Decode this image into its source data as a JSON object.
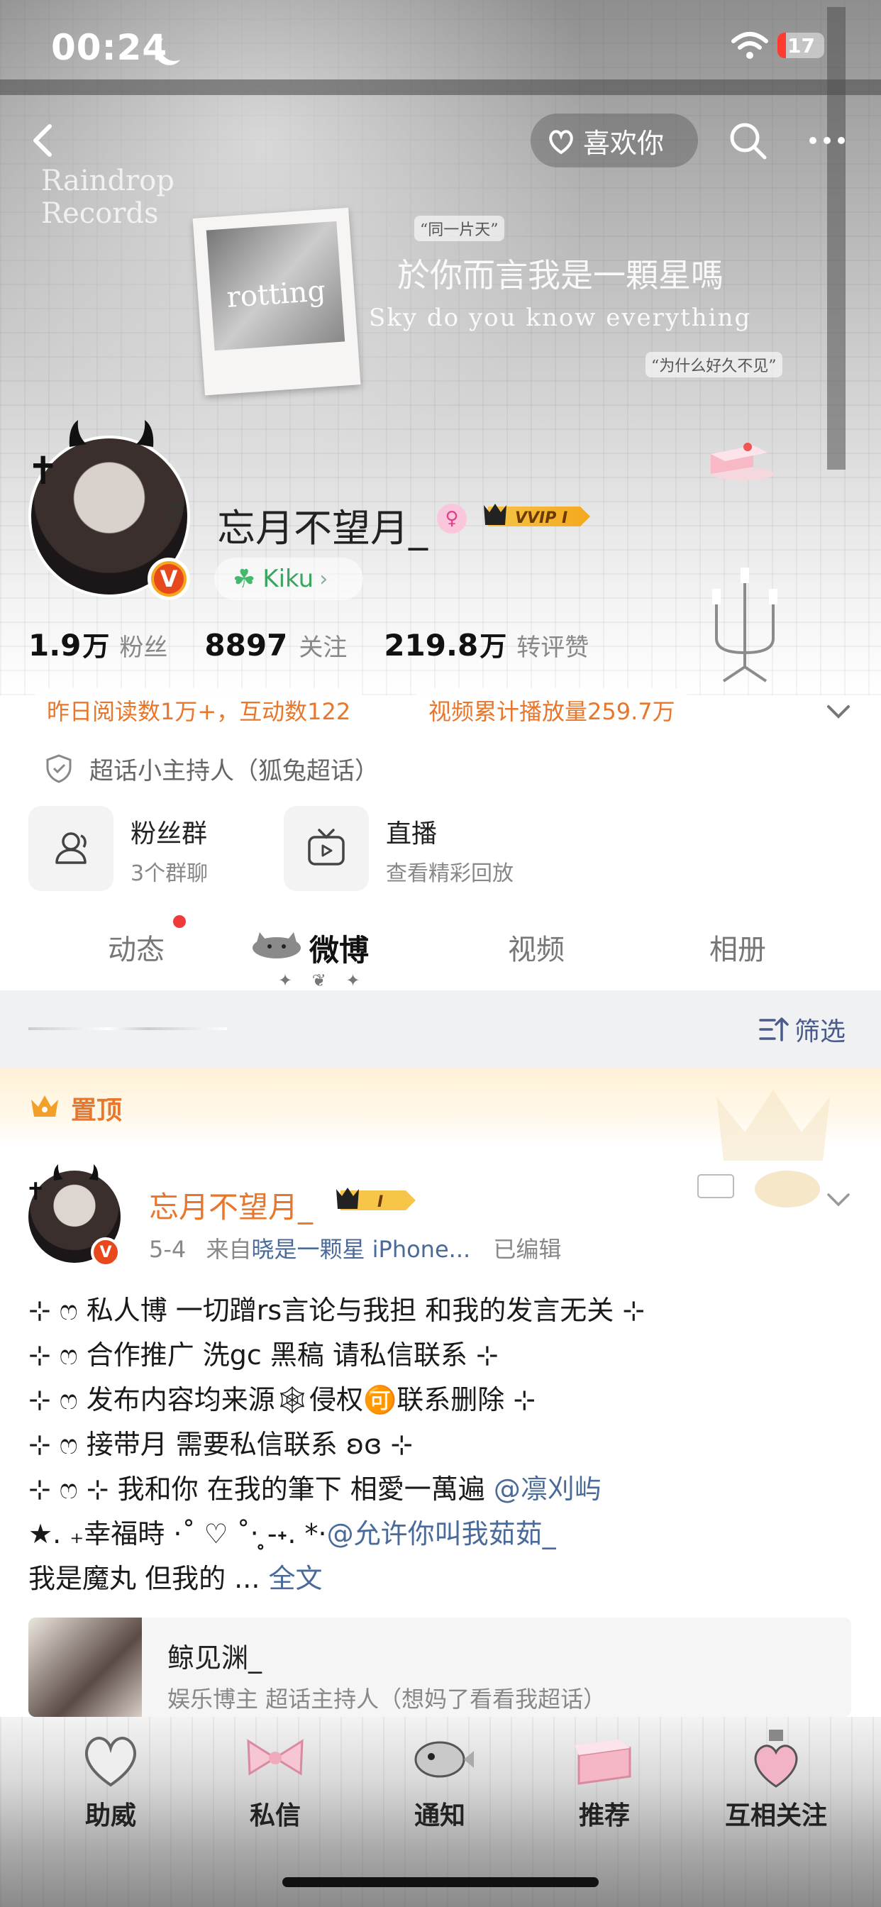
{
  "status": {
    "time": "00:24",
    "battery": "17"
  },
  "nav": {
    "like_label": "喜欢你"
  },
  "banner_text": {
    "tag_left": "Raindrop Records",
    "quote1": "“同一片天”",
    "title_cn": "於你而言我是一顆星嗎",
    "title_en": "Sky do you know everything",
    "quote2": "“为什么好久不见”",
    "polaroid_word": "rotting"
  },
  "profile": {
    "name": "忘月不望月_",
    "vip_label": "VVIP I",
    "badge_v": "V",
    "group": "Kiku",
    "stats": [
      {
        "num": "1.9",
        "unit": "万",
        "label": "粉丝"
      },
      {
        "num": "8897",
        "unit": "",
        "label": "关注"
      },
      {
        "num": "219.8",
        "unit": "万",
        "label": "转评赞"
      }
    ],
    "pills": [
      "昨日阅读数1万+，互动数122",
      "视频累计播放量259.7万"
    ],
    "host": "超话小主持人（狐兔超话）"
  },
  "features": [
    {
      "title": "粉丝群",
      "sub": "3个群聊",
      "icon": "users-icon"
    },
    {
      "title": "直播",
      "sub": "查看精彩回放",
      "icon": "tv-icon"
    }
  ],
  "tabs": [
    "动态",
    "微博",
    "视频",
    "相册"
  ],
  "tab_ornament": "✦ ❦ ✦",
  "filter": {
    "label": "筛选"
  },
  "pinned": {
    "label": "置顶"
  },
  "post": {
    "author": "忘月不望月_",
    "vip": "I",
    "date": "5-4",
    "from_prefix": "来自",
    "source": "晓是一颗星 iPhone...",
    "edited": "已编辑",
    "lines": [
      {
        "text": "⊹ ෆ 私人博 一切蹭rs言论与我担 和我的发言无关 ⊹",
        "mention": ""
      },
      {
        "text": "⊹ ෆ 合作推广 洗gc 黑稿 请私信联系 ⊹",
        "mention": ""
      },
      {
        "text": "⊹ ෆ 发布内容均来源🕸侵权🉑联系删除 ⊹",
        "mention": ""
      },
      {
        "text": "⊹ ෆ 接带月 需要私信联系 ʚɞ ⊹",
        "mention": ""
      },
      {
        "text": "⊹ ෆ ⊹ 我和你 在我的筆下 相愛一萬遍 ",
        "mention": "@凛刈屿"
      },
      {
        "text": "★. ₊幸福時 ·˚ ♡ ˚‧ ̥-˖. *·",
        "mention": "@允许你叫我茹茹_"
      }
    ],
    "last_line": "我是魔丸 但我的 ...",
    "full_text": "全文"
  },
  "share_card": {
    "title": "鲸见渊_",
    "sub": "娱乐博主 超话主持人（想妈了看看我超话）"
  },
  "bottom_nav": [
    "助威",
    "私信",
    "通知",
    "推荐",
    "互相关注"
  ],
  "colors": {
    "accent_orange": "#e8762b",
    "link_blue": "#4a6a9a",
    "kiku_green": "#3aa55f",
    "red_dot": "#f03a3a"
  }
}
